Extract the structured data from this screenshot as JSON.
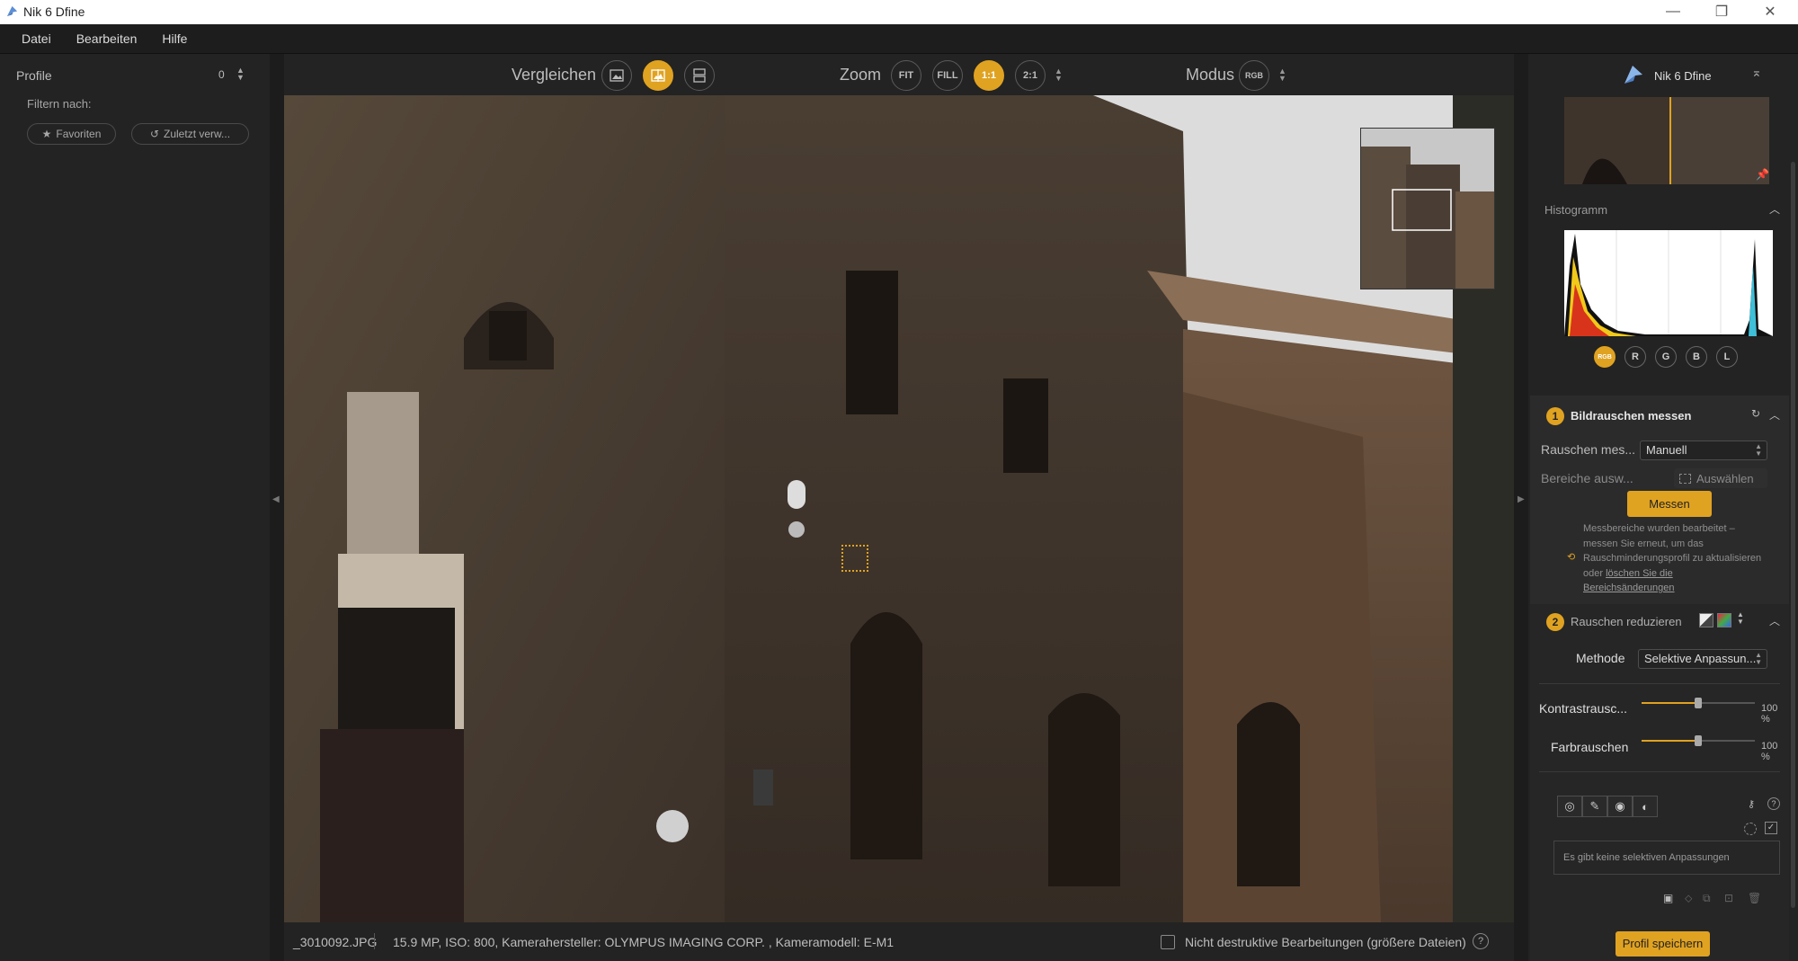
{
  "window": {
    "title": "Nik 6 Dfine",
    "controls": {
      "minimize": "—",
      "maximize": "❐",
      "close": "✕"
    }
  },
  "menu": [
    "Datei",
    "Bearbeiten",
    "Hilfe"
  ],
  "left_panel": {
    "header": "Profile",
    "count": "0",
    "filter_label": "Filtern nach:",
    "favorites": "Favoriten",
    "recent": "Zuletzt verw..."
  },
  "toolbar": {
    "compare_label": "Vergleichen",
    "zoom_label": "Zoom",
    "zoom_fit": "FIT",
    "zoom_fill": "FILL",
    "zoom_1to1": "1:1",
    "zoom_2to1": "2:1",
    "mode_label": "Modus",
    "mode_value": "RGB"
  },
  "status_bar": {
    "filename": "_3010092.JPG",
    "info": "15.9 MP, ISO: 800, Kamerahersteller: OLYMPUS IMAGING CORP. , Kameramodell: E-M1",
    "nondestructive": "Nicht destruktive Bearbeitungen (größere Dateien)",
    "help": "?"
  },
  "right_panel": {
    "app_name": "Nik 6 Dfine",
    "histogram": {
      "title": "Histogramm",
      "channels": [
        "RGB",
        "R",
        "G",
        "B",
        "L"
      ],
      "active_channel": "RGB"
    },
    "step1": {
      "number": "1",
      "title": "Bildrauschen messen",
      "measure_label": "Rauschen mes...",
      "measure_value": "Manuell",
      "regions_label": "Bereiche ausw...",
      "select_button": "Auswählen",
      "measure_button": "Messen",
      "info_text": "Messbereiche wurden bearbeitet – messen Sie erneut, um das Rauschminderungsprofil zu aktualisieren oder",
      "info_link": "löschen Sie die Bereichsänderungen"
    },
    "step2": {
      "number": "2",
      "title": "Rauschen reduzieren",
      "method_label": "Methode",
      "method_value": "Selektive Anpassun...",
      "contrast_label": "Kontrastrausc...",
      "contrast_value": "100 %",
      "contrast_level": 0.5,
      "color_label": "Farbrauschen",
      "color_value": "100 %",
      "color_level": 0.5,
      "no_adjustments": "Es gibt keine selektiven Anpassungen"
    },
    "save_profile": "Profil speichern"
  },
  "colors": {
    "accent": "#e0a221",
    "panel": "#232323",
    "background": "#1a1a1a"
  }
}
